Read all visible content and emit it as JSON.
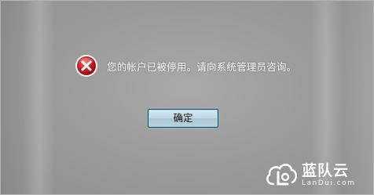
{
  "dialog": {
    "message": "您的帐户已被停用。请向系统管理员咨询。",
    "icon": "error-icon",
    "ok_label": "确定"
  },
  "watermark": {
    "brand_cn": "蓝队云",
    "brand_en": "LanDui.com",
    "icon": "cloud-icon"
  },
  "colors": {
    "background": "#9c9c9c",
    "error_red": "#c0262c",
    "button_glow": "#8fe0ff"
  }
}
